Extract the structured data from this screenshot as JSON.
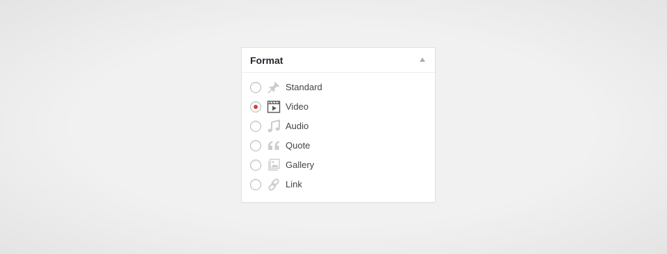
{
  "format_box": {
    "title": "Format",
    "selected": "video",
    "options": [
      {
        "id": "standard",
        "label": "Standard",
        "icon": "pin-icon",
        "checked": false
      },
      {
        "id": "video",
        "label": "Video",
        "icon": "video-icon",
        "checked": true
      },
      {
        "id": "audio",
        "label": "Audio",
        "icon": "music-note-icon",
        "checked": false
      },
      {
        "id": "quote",
        "label": "Quote",
        "icon": "quote-icon",
        "checked": false
      },
      {
        "id": "gallery",
        "label": "Gallery",
        "icon": "gallery-icon",
        "checked": false
      },
      {
        "id": "link",
        "label": "Link",
        "icon": "link-icon",
        "checked": false
      }
    ]
  },
  "colors": {
    "background": "#f1f1f1",
    "panel": "#ffffff",
    "radio_selected": "#dd3d36",
    "icon_muted": "#cccccc",
    "icon_active": "#555555",
    "text": "#444444"
  }
}
